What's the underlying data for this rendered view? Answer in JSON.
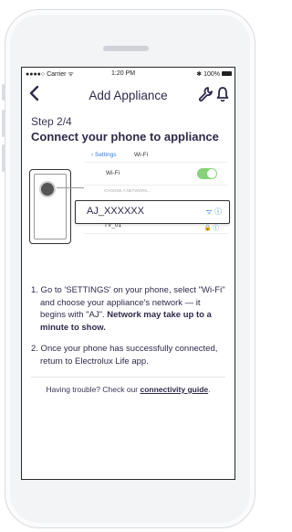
{
  "status_bar": {
    "carrier": "●●●●○ Carrier ᯤ",
    "time": "1:20 PM",
    "battery": "✱ 100%"
  },
  "nav": {
    "back_icon": "chevron-left",
    "title": "Add Appliance",
    "wrench_icon": "wrench",
    "bell_icon": "bell"
  },
  "step": {
    "label": "Step 2/4",
    "title": "Connect your phone to appliance"
  },
  "wifi_panel": {
    "settings_link": "Settings",
    "title": "Wi-Fi",
    "wifi_label": "Wi-Fi",
    "wifi_on": true,
    "choose_label": "CHOOSE A NETWORK...",
    "highlighted_network": "AJ_XXXXXX",
    "networks": [
      "TV_01"
    ]
  },
  "instructions": {
    "item1_text": "1. Go to 'SETTINGS' on your phone, select \"Wi-Fi\" and choose your appliance's network — it begins with \"AJ\". ",
    "item1_bold": "Network may take up to a minute to show.",
    "item2_text": "2. Once your phone has successfully connected, return to Electrolux Life app."
  },
  "help": {
    "text": "Having trouble? Check our ",
    "link": "connectivity guide",
    "suffix": "."
  },
  "colors": {
    "text": "#2f2a4a",
    "accent_blue": "#2b7de9",
    "toggle_green": "#86d37a"
  }
}
